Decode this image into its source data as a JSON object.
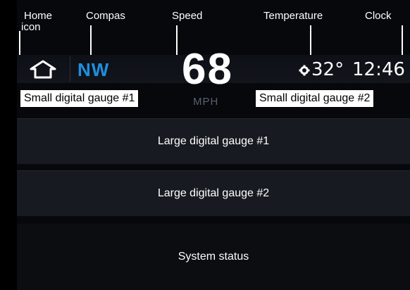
{
  "callouts": {
    "home": "Home\nicon",
    "home_line1": "Home",
    "home_line2": "icon",
    "compas": "Compas",
    "speed": "Speed",
    "temperature": "Temperature",
    "clock": "Clock"
  },
  "dashboard": {
    "compass_heading": "NW",
    "speed_value": "68",
    "speed_unit": "MPH",
    "temperature": "32°",
    "clock_time": "12:46",
    "small_gauge_1": "Small digital gauge #1",
    "small_gauge_2": "Small digital gauge #2",
    "large_gauge_1": "Large digital gauge #1",
    "large_gauge_2": "Large digital gauge #2",
    "system_status": "System status"
  },
  "icons": {
    "home": "home-icon",
    "settings": "gear-icon"
  },
  "colors": {
    "background": "#06080c",
    "compass_accent": "#1e8fe0",
    "text": "#ffffff",
    "unit_text": "#5a6170"
  }
}
